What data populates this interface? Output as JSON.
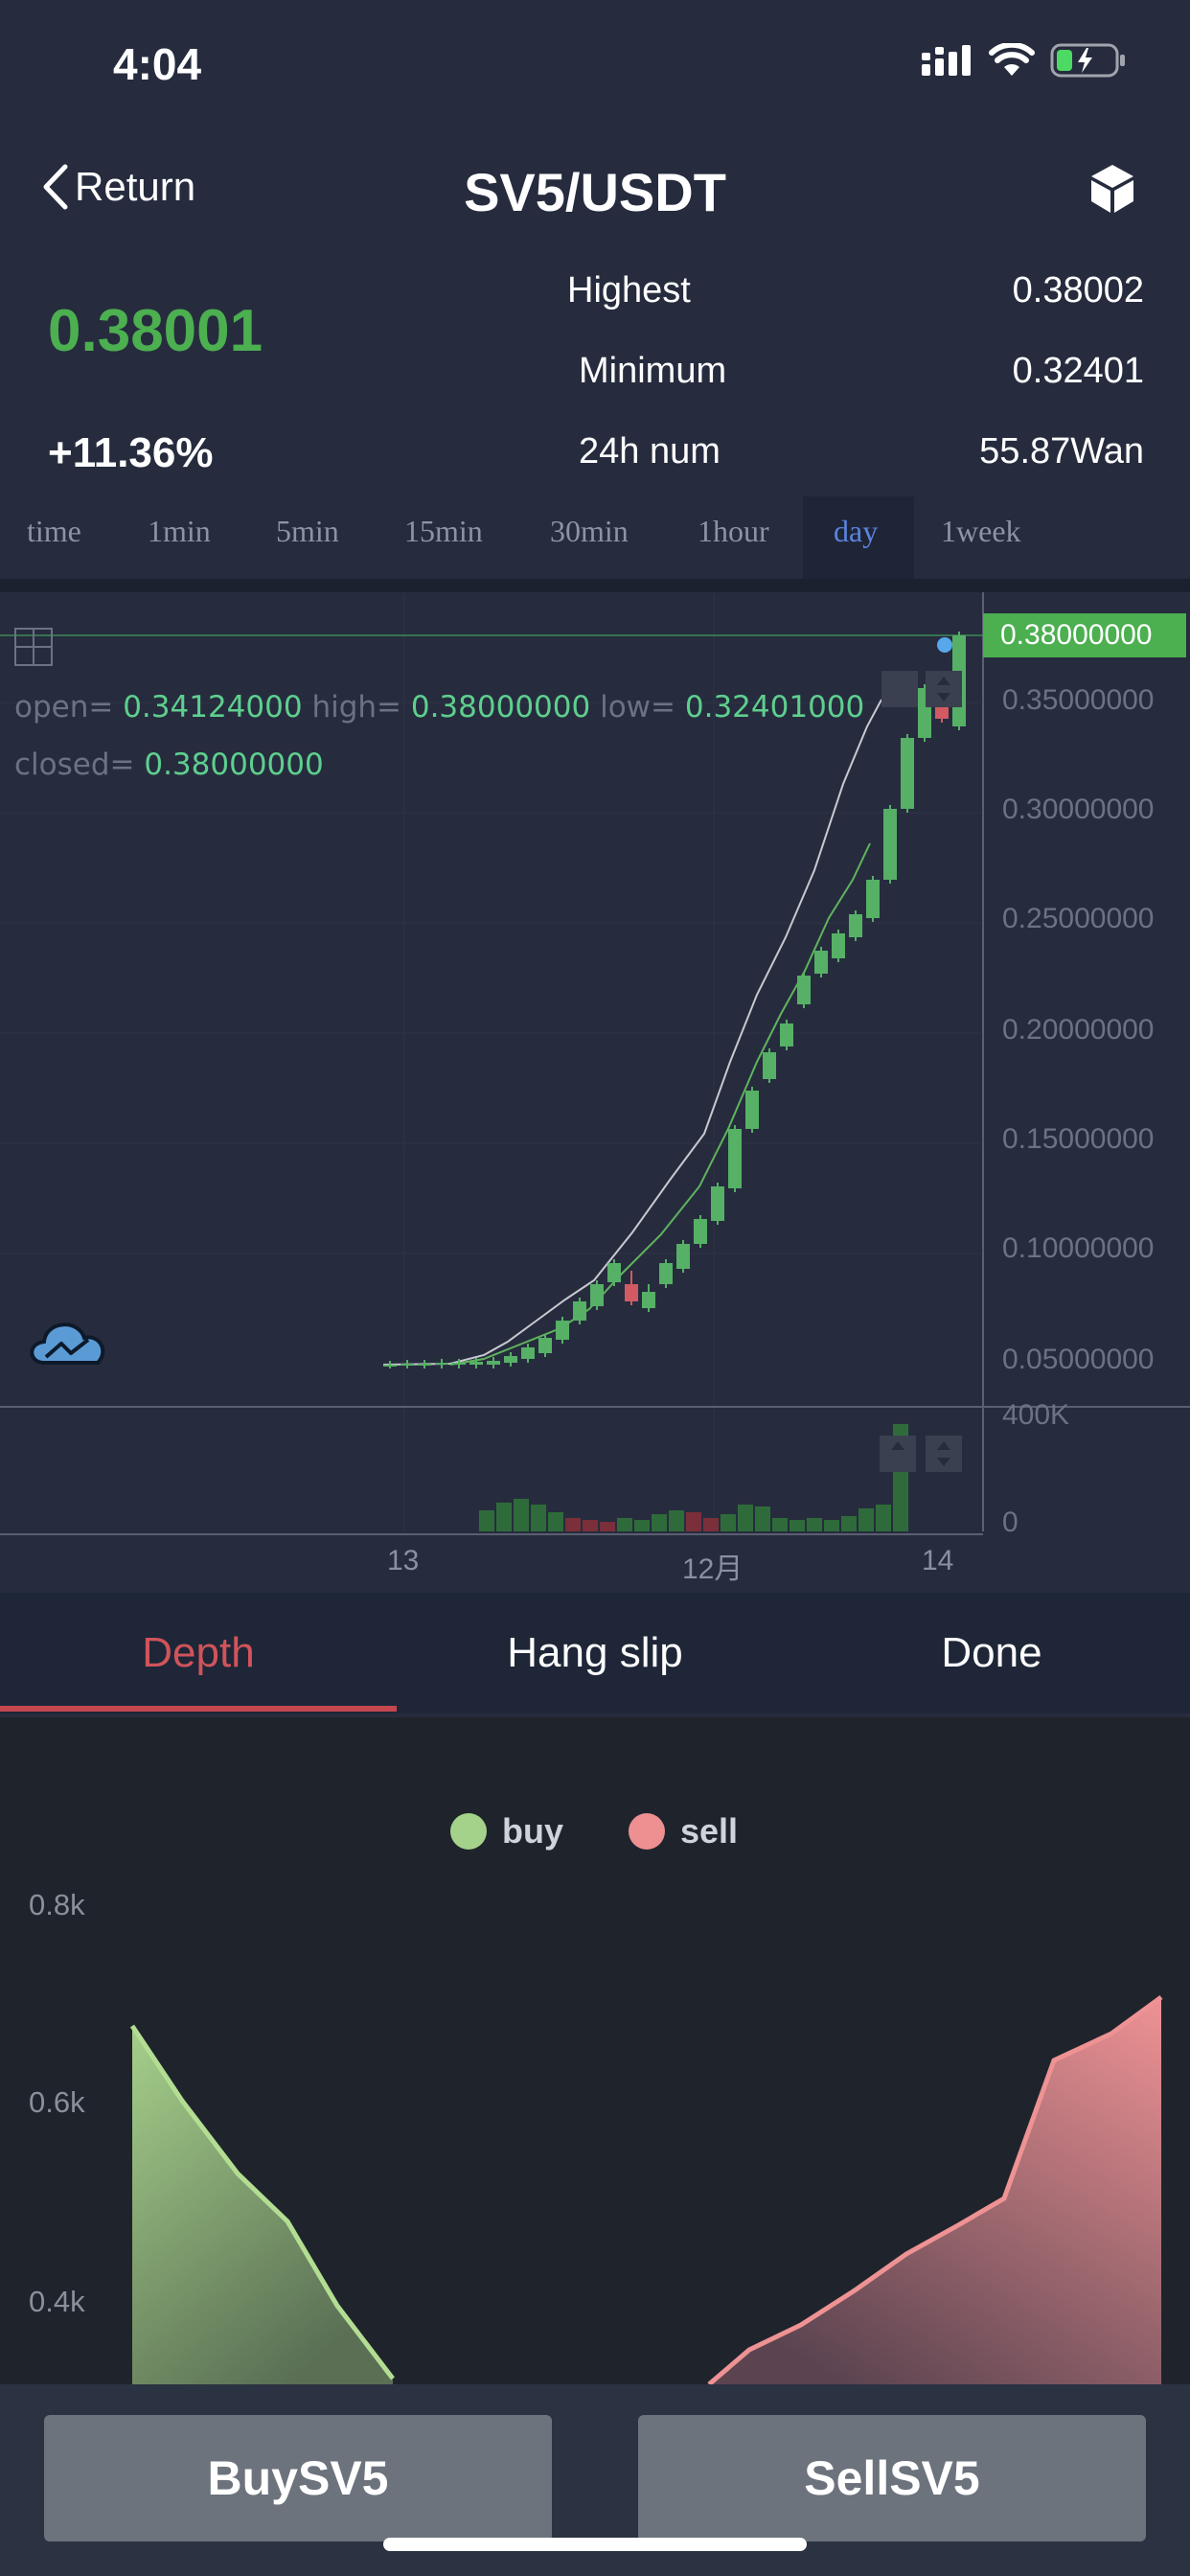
{
  "status": {
    "time": "4:04"
  },
  "nav": {
    "back_label": "Return",
    "title": "SV5/USDT",
    "cube_icon": "cube-icon"
  },
  "ticker": {
    "price": "0.38001",
    "change": "+11.36%",
    "highest_label": "Highest",
    "highest_value": "0.38002",
    "minimum_label": "Minimum",
    "minimum_value": "0.32401",
    "volume_label": "24h num",
    "volume_value": "55.87Wan",
    "price_color": "#4caf50"
  },
  "intervals": [
    "time",
    "1min",
    "5min",
    "15min",
    "30min",
    "1hour",
    "day",
    "1week"
  ],
  "active_interval": "day",
  "ohlc": {
    "open_label": "open=",
    "open": "0.34124000",
    "high_label": "high=",
    "high": "0.38000000",
    "low_label": "low=",
    "low": "0.32401000",
    "closed_label": "closed=",
    "closed": "0.38000000"
  },
  "kline": {
    "current_price_tag": "0.38000000",
    "y_ticks": [
      "0.35000000",
      "0.30000000",
      "0.25000000",
      "0.20000000",
      "0.15000000",
      "0.10000000",
      "0.05000000"
    ],
    "vol_ticks": [
      "400K",
      "0"
    ],
    "x_ticks": [
      "13",
      "12月",
      "14"
    ],
    "up_color": "#56b066",
    "down_color": "#d25a62"
  },
  "depth_tabs": [
    "Depth",
    "Hang slip",
    "Done"
  ],
  "depth_legend": {
    "buy": "buy",
    "sell": "sell",
    "buy_color": "#a4d28a",
    "sell_color": "#ee8f92"
  },
  "depth_y_ticks": [
    "0.8k",
    "0.6k",
    "0.4k"
  ],
  "actions": {
    "buy": "BuySV5",
    "sell": "SellSV5"
  }
}
